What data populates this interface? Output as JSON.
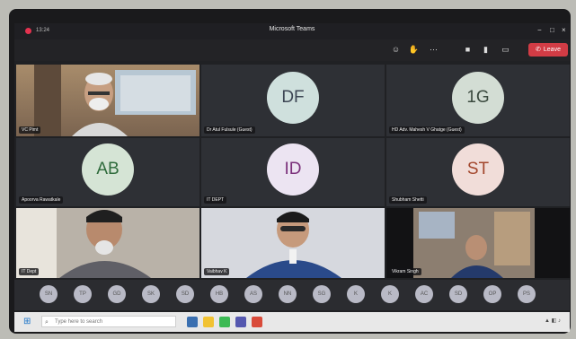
{
  "window": {
    "title": "Microsoft Teams",
    "timer": "13:24"
  },
  "toolbar": {
    "leave_label": "Leave"
  },
  "tiles": [
    {
      "name": "VC Pimt",
      "type": "video"
    },
    {
      "name": "Dr Atul Fulsule (Guest)",
      "type": "avatar",
      "initials": "DF",
      "bg": "#cfe0dd",
      "fg": "#3d4654"
    },
    {
      "name": "HD Adv. Mahesh V Ghatge (Guest)",
      "type": "avatar",
      "initials": "1G",
      "bg": "#d3ddd4",
      "fg": "#3b4a3f"
    },
    {
      "name": "Apoorva Rawatkale",
      "type": "avatar",
      "initials": "AB",
      "bg": "#d5e4d5",
      "fg": "#2f6b3c"
    },
    {
      "name": "IT DEPT",
      "type": "avatar",
      "initials": "ID",
      "bg": "#ece4f2",
      "fg": "#7a2f7a"
    },
    {
      "name": "Shubham Shetti",
      "type": "avatar",
      "initials": "ST",
      "bg": "#f1ddd9",
      "fg": "#a3472d"
    },
    {
      "name": "IT Dept",
      "type": "video"
    },
    {
      "name": "Vaibhav K",
      "type": "video"
    },
    {
      "name": "Vikram Singh",
      "type": "video"
    }
  ],
  "participants": [
    "SN",
    "TP",
    "GD",
    "SK",
    "SD",
    "HB",
    "AS",
    "NN",
    "SG",
    "K",
    "K",
    "AC",
    "SD",
    "OP",
    "PS"
  ],
  "taskbar": {
    "search_placeholder": "Type here to search"
  },
  "colors": {
    "leave": "#d23c45",
    "app_bg": "#202124",
    "rec": "#e3324f"
  }
}
